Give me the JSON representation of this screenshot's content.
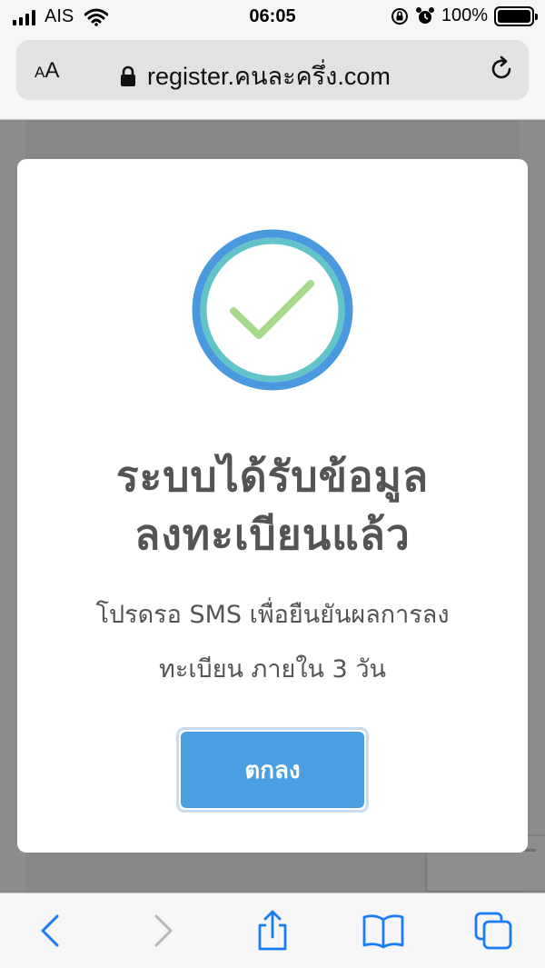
{
  "status_bar": {
    "carrier": "AIS",
    "time": "06:05",
    "battery_percent": "100%",
    "battery_level": 1.0,
    "icons": [
      "signal-icon",
      "wifi-icon",
      "orientation-lock-icon",
      "alarm-icon",
      "battery-icon"
    ]
  },
  "address_bar": {
    "text_size_label_small": "A",
    "text_size_label_large": "A",
    "url": "register.คนละครึ่ง.com",
    "icons": [
      "lock-icon",
      "reload-icon"
    ]
  },
  "modal": {
    "title_line1": "ระบบได้รับข้อมูล",
    "title_line2": "ลงทะเบียนแล้ว",
    "message_line1": "โปรดรอ SMS เพื่อยืนยันผลการลง",
    "message_line2": "ทะเบียน ภายใน 3 วัน",
    "ok_label": "ตกลง",
    "icon": "success-check-icon"
  },
  "toolbar": {
    "icons": [
      "back-icon",
      "forward-icon",
      "share-icon",
      "bookmarks-icon",
      "tabs-icon"
    ]
  },
  "colors": {
    "accent_blue": "#4a9fe2",
    "ring_blue": "#4a98de",
    "ring_teal": "#62c3c8",
    "check_green": "#a6d98a",
    "text_gray": "#545454",
    "ios_blue": "#1a7cf5"
  }
}
